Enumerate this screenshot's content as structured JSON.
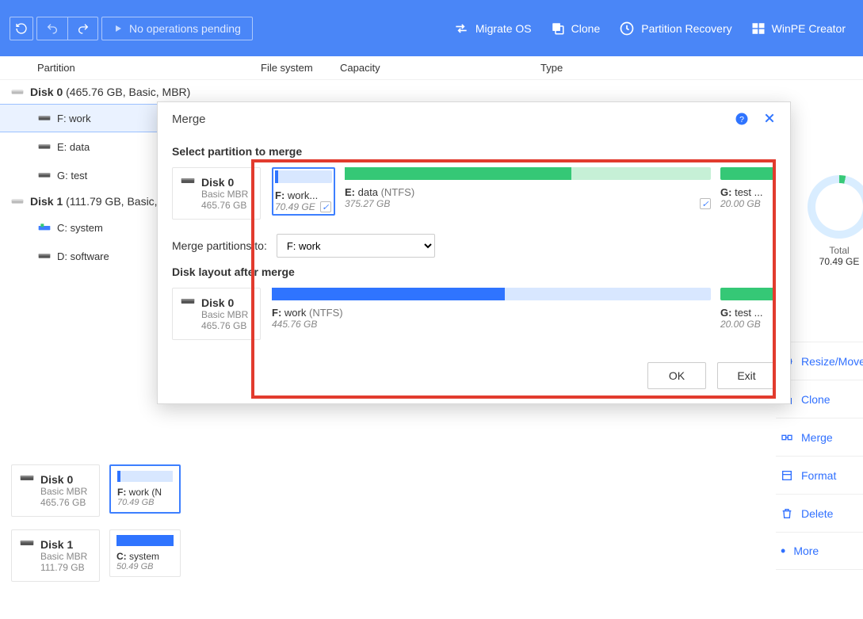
{
  "toolbar": {
    "pending": "No operations pending",
    "migrate": "Migrate OS",
    "clone": "Clone",
    "recovery": "Partition Recovery",
    "winpe": "WinPE Creator"
  },
  "headers": {
    "partition": "Partition",
    "fs": "File system",
    "capacity": "Capacity",
    "type": "Type"
  },
  "tree": {
    "disk0": {
      "name": "Disk 0",
      "info": "(465.76 GB, Basic, MBR)",
      "parts": [
        "F: work",
        "E: data",
        "G: test"
      ]
    },
    "disk1": {
      "name": "Disk 1",
      "info": "(111.79 GB, Basic,",
      "parts": [
        "C: system",
        "D: software"
      ]
    }
  },
  "bottom": {
    "d0": {
      "name": "Disk 0",
      "type": "Basic MBR",
      "size": "465.76 GB",
      "p_label": "F:",
      "p_rest": "work (N",
      "p_size": "70.49 GB"
    },
    "d1": {
      "name": "Disk 1",
      "type": "Basic MBR",
      "size": "111.79 GB",
      "p_label": "C:",
      "p_rest": "system",
      "p_size": "50.49 GB"
    }
  },
  "pie": {
    "total_label": "Total",
    "total_value": "70.49 GE"
  },
  "actions": {
    "resize": "Resize/Move",
    "clone": "Clone",
    "merge": "Merge",
    "format": "Format",
    "delete": "Delete",
    "more": "More"
  },
  "dialog": {
    "title": "Merge",
    "select_label": "Select partition to merge",
    "disk": {
      "name": "Disk 0",
      "type": "Basic MBR",
      "size": "465.76 GB"
    },
    "p_f": {
      "label": "F:",
      "name": "work...",
      "size": "70.49 GE"
    },
    "p_e": {
      "label": "E:",
      "name": "data",
      "fs": "(NTFS)",
      "size": "375.27 GB"
    },
    "p_g": {
      "label": "G:",
      "name": "test ...",
      "size": "20.00 GB"
    },
    "merge_to_label": "Merge partitions to:",
    "merge_to_value": "F: work",
    "after_label": "Disk layout after merge",
    "after_disk": {
      "name": "Disk 0",
      "type": "Basic MBR",
      "size": "465.76 GB"
    },
    "after_f": {
      "label": "F:",
      "name": "work",
      "fs": "(NTFS)",
      "size": "445.76 GB"
    },
    "after_g": {
      "label": "G:",
      "name": "test ...",
      "size": "20.00 GB"
    },
    "ok": "OK",
    "exit": "Exit"
  }
}
